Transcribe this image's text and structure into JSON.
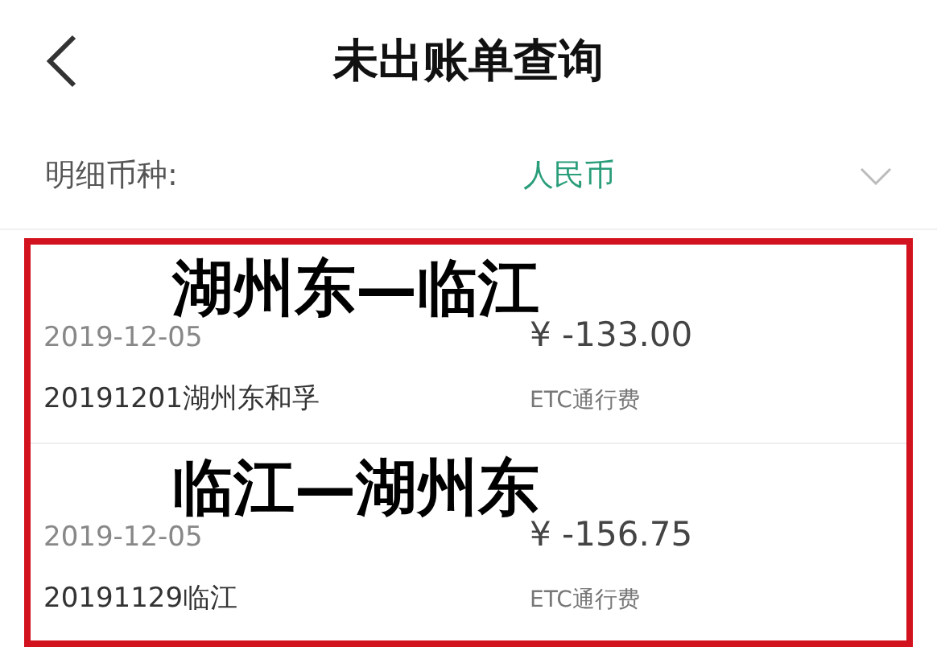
{
  "header": {
    "title": "未出账单查询"
  },
  "currency": {
    "label": "明细币种:",
    "value": "人民币"
  },
  "records": [
    {
      "annotation": "湖州东—临江",
      "date": "2019-12-05",
      "amount": "¥ -133.00",
      "description": "20191201湖州东和孚",
      "type": "ETC通行费"
    },
    {
      "annotation": "临江—湖州东",
      "date": "2019-12-05",
      "amount": "¥ -156.75",
      "description": "20191129临江",
      "type": "ETC通行费"
    }
  ],
  "highlight": {
    "on": true
  }
}
